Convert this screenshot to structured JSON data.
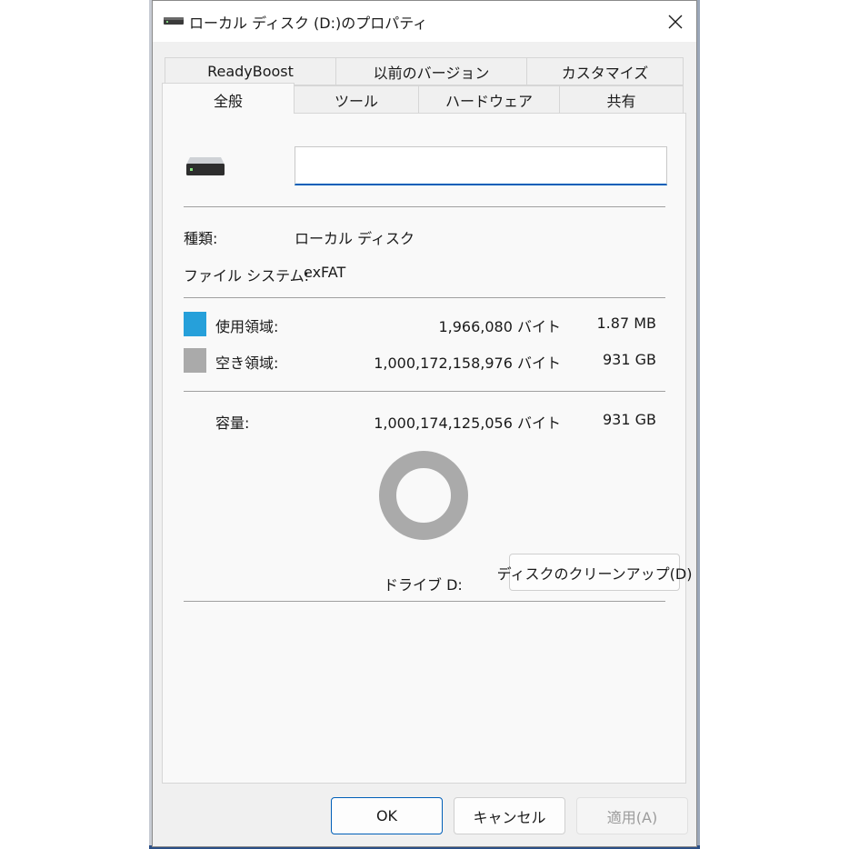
{
  "window": {
    "title": "ローカル ディスク (D:)のプロパティ"
  },
  "tabs": {
    "row1": [
      "ReadyBoost",
      "以前のバージョン",
      "カスタマイズ"
    ],
    "row2": [
      "全般",
      "ツール",
      "ハードウェア",
      "共有"
    ],
    "active": "全般"
  },
  "general": {
    "drive_icon": "hard-drive-icon",
    "name_value": "",
    "type_label": "種類:",
    "type_value": "ローカル ディスク",
    "fs_label": "ファイル システム:",
    "fs_value": "exFAT",
    "used": {
      "label": "使用領域:",
      "bytes": "1,966,080 バイト",
      "size": "1.87 MB",
      "color": "#26a0da"
    },
    "free": {
      "label": "空き領域:",
      "bytes": "1,000,172,158,976 バイト",
      "size": "931 GB",
      "color": "#aaaaaa"
    },
    "capacity": {
      "label": "容量:",
      "bytes": "1,000,174,125,056 バイト",
      "size": "931 GB"
    },
    "used_fraction": 2e-06,
    "drive_label": "ドライブ D:",
    "cleanup_button": "ディスクのクリーンアップ(D)"
  },
  "buttons": {
    "ok": "OK",
    "cancel": "キャンセル",
    "apply": "適用(A)"
  },
  "colors": {
    "accent": "#005fb8",
    "used": "#26a0da",
    "free": "#aaaaaa"
  }
}
